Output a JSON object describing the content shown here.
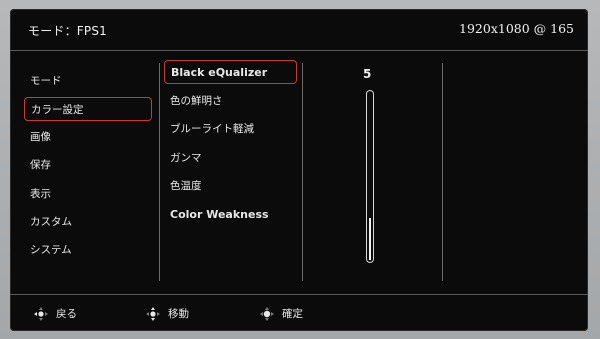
{
  "header": {
    "title": "モード：FPS1",
    "resolution": "1920x1080 @ 165"
  },
  "menu_main": {
    "items": [
      {
        "label": "モード"
      },
      {
        "label": "カラー設定"
      },
      {
        "label": "画像"
      },
      {
        "label": "保存"
      },
      {
        "label": "表示"
      },
      {
        "label": "カスタム"
      },
      {
        "label": "システム"
      }
    ],
    "selected": "カラー設定"
  },
  "menu_sub": {
    "items": [
      {
        "label": "Black eQualizer"
      },
      {
        "label": "色の鮮明さ"
      },
      {
        "label": "ブルーライト軽減"
      },
      {
        "label": "ガンマ"
      },
      {
        "label": "色温度"
      },
      {
        "label": "Color Weakness"
      }
    ],
    "selected": "Black eQualizer"
  },
  "setting": {
    "value": "5",
    "level_fraction": 0.25
  },
  "footer": {
    "back_label": "戻る",
    "move_label": "移動",
    "confirm_label": "確定",
    "back_icon": "joystick-left-icon",
    "move_icon": "joystick-updown-icon",
    "confirm_icon": "joystick-press-icon"
  },
  "colors": {
    "accent": "#c33a3f",
    "background": "#0b0b0c",
    "text": "#e8e8e8"
  }
}
